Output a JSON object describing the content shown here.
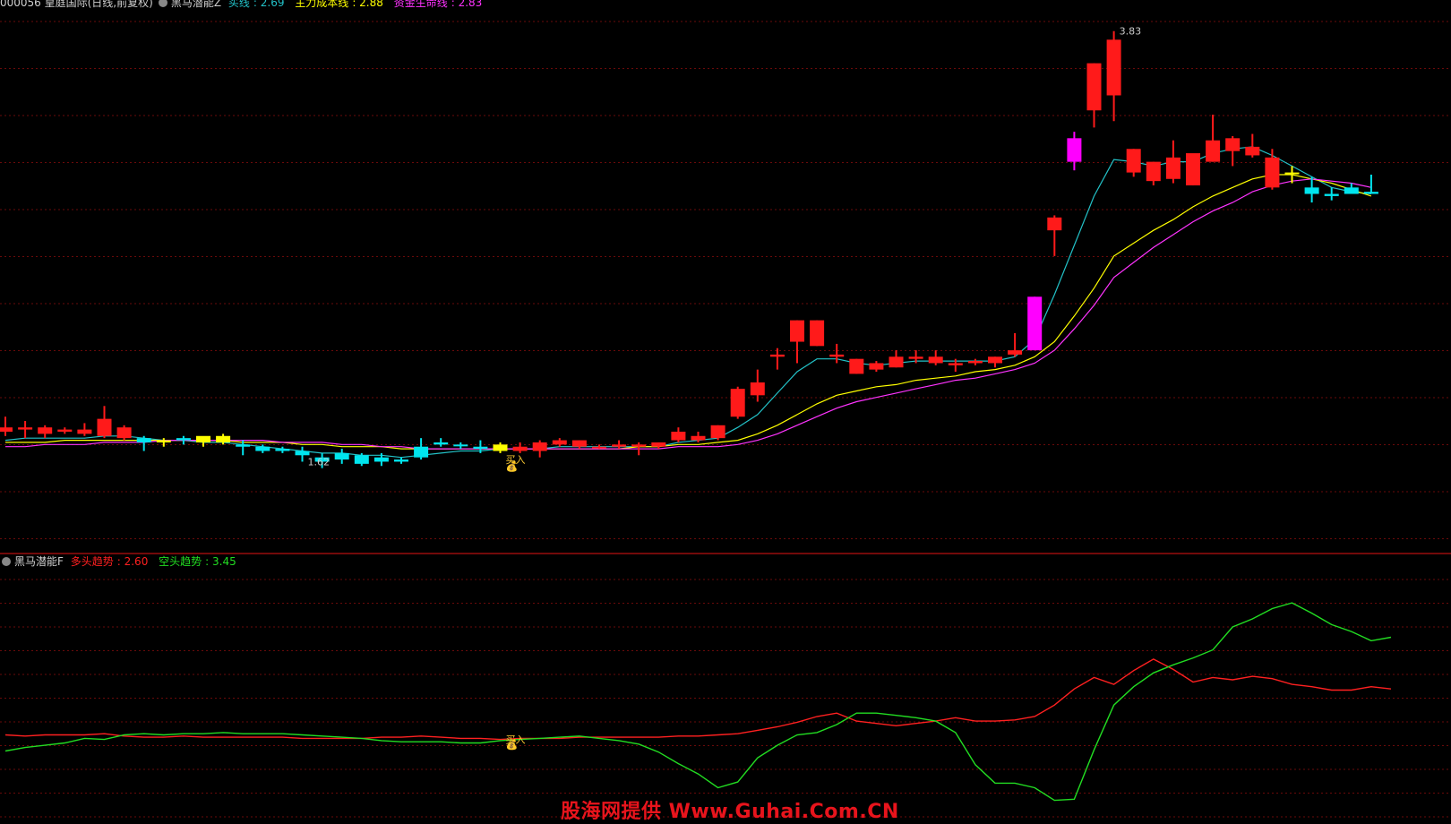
{
  "header": {
    "title": "000056 皇庭国际(日线,前复权)",
    "indicator": "黑马潜能Z",
    "items": [
      {
        "label": "买线",
        "value": "2.69",
        "color": "#23c2c8"
      },
      {
        "label": "主力成本线",
        "value": "2.88",
        "color": "#ffff00"
      },
      {
        "label": "资金生命线",
        "value": "2.83",
        "color": "#ff33ff"
      }
    ]
  },
  "sub_header": {
    "indicator": "黑马潜能F",
    "items": [
      {
        "label": "多头趋势",
        "value": "2.60",
        "color": "#ff2020"
      },
      {
        "label": "空头趋势",
        "value": "3.45",
        "color": "#22dd22"
      }
    ]
  },
  "watermark": "股海网提供 Www.Guhai.Com.CN",
  "chart_data": [
    {
      "type": "candlestick",
      "name": "main",
      "ylim": [
        1.5,
        3.9
      ],
      "bull_color": "#ff1a1a",
      "bear_color": "#00e5ee",
      "signal_color": "#ff00ff",
      "warning_color": "#ffff00",
      "candles": [
        [
          1.98,
          2.03,
          1.94,
          1.96,
          "bull"
        ],
        [
          1.97,
          2.01,
          1.93,
          1.98,
          "bull"
        ],
        [
          1.95,
          1.99,
          1.93,
          1.98,
          "bull"
        ],
        [
          1.96,
          1.98,
          1.95,
          1.97,
          "bull"
        ],
        [
          1.95,
          2.0,
          1.94,
          1.97,
          "bull"
        ],
        [
          1.94,
          2.08,
          1.93,
          2.02,
          "bull"
        ],
        [
          1.93,
          1.99,
          1.92,
          1.98,
          "bull"
        ],
        [
          1.93,
          1.94,
          1.87,
          1.91,
          "bear"
        ],
        [
          1.91,
          1.93,
          1.89,
          1.92,
          "warn"
        ],
        [
          1.92,
          1.94,
          1.9,
          1.93,
          "bear"
        ],
        [
          1.91,
          1.93,
          1.89,
          1.94,
          "warn"
        ],
        [
          1.91,
          1.95,
          1.9,
          1.94,
          "warn"
        ],
        [
          1.9,
          1.92,
          1.85,
          1.89,
          "bear"
        ],
        [
          1.89,
          1.9,
          1.86,
          1.87,
          "bear"
        ],
        [
          1.88,
          1.89,
          1.86,
          1.87,
          "bear"
        ],
        [
          1.87,
          1.89,
          1.82,
          1.85,
          "bear"
        ],
        [
          1.84,
          1.86,
          1.79,
          1.82,
          "bear"
        ],
        [
          1.86,
          1.88,
          1.81,
          1.83,
          "bear"
        ],
        [
          1.85,
          1.86,
          1.8,
          1.81,
          "bear"
        ],
        [
          1.84,
          1.86,
          1.8,
          1.82,
          "bear"
        ],
        [
          1.83,
          1.84,
          1.81,
          1.82,
          "bear"
        ],
        [
          1.89,
          1.93,
          1.83,
          1.84,
          "bear"
        ],
        [
          1.91,
          1.93,
          1.89,
          1.9,
          "bear"
        ],
        [
          1.9,
          1.91,
          1.88,
          1.9,
          "bear"
        ],
        [
          1.89,
          1.92,
          1.86,
          1.88,
          "bear"
        ],
        [
          1.87,
          1.91,
          1.86,
          1.9,
          "warn"
        ],
        [
          1.87,
          1.91,
          1.86,
          1.89,
          "bull"
        ],
        [
          1.87,
          1.92,
          1.84,
          1.91,
          "bull"
        ],
        [
          1.9,
          1.93,
          1.89,
          1.92,
          "bull"
        ],
        [
          1.89,
          1.92,
          1.88,
          1.92,
          "bull"
        ],
        [
          1.89,
          1.9,
          1.88,
          1.89,
          "bull"
        ],
        [
          1.89,
          1.92,
          1.88,
          1.9,
          "bull"
        ],
        [
          1.89,
          1.91,
          1.85,
          1.9,
          "bull"
        ],
        [
          1.89,
          1.91,
          1.88,
          1.91,
          "bull"
        ],
        [
          1.92,
          1.98,
          1.91,
          1.96,
          "bull"
        ],
        [
          1.92,
          1.96,
          1.91,
          1.94,
          "bull"
        ],
        [
          1.93,
          1.99,
          1.92,
          1.99,
          "bull"
        ],
        [
          2.03,
          2.17,
          2.02,
          2.16,
          "bull"
        ],
        [
          2.13,
          2.25,
          2.1,
          2.19,
          "bull"
        ],
        [
          2.32,
          2.35,
          2.25,
          2.31,
          "bull"
        ],
        [
          2.38,
          2.48,
          2.28,
          2.48,
          "bull"
        ],
        [
          2.36,
          2.48,
          2.36,
          2.48,
          "bull"
        ],
        [
          2.32,
          2.37,
          2.28,
          2.31,
          "bull"
        ],
        [
          2.23,
          2.3,
          2.23,
          2.3,
          "bull"
        ],
        [
          2.25,
          2.29,
          2.24,
          2.28,
          "bull"
        ],
        [
          2.26,
          2.34,
          2.26,
          2.31,
          "bull"
        ],
        [
          2.3,
          2.34,
          2.28,
          2.31,
          "bull"
        ],
        [
          2.28,
          2.34,
          2.27,
          2.31,
          "bull"
        ],
        [
          2.27,
          2.3,
          2.24,
          2.28,
          "bull"
        ],
        [
          2.28,
          2.3,
          2.27,
          2.29,
          "bull"
        ],
        [
          2.28,
          2.31,
          2.26,
          2.31,
          "bull"
        ],
        [
          2.32,
          2.42,
          2.31,
          2.34,
          "bull"
        ],
        [
          2.34,
          2.59,
          2.34,
          2.59,
          "signal"
        ],
        [
          2.9,
          2.97,
          2.78,
          2.96,
          "bull"
        ],
        [
          3.22,
          3.36,
          3.18,
          3.33,
          "signal"
        ],
        [
          3.46,
          3.68,
          3.38,
          3.68,
          "bull"
        ],
        [
          3.53,
          3.83,
          3.41,
          3.79,
          "bull"
        ],
        [
          3.17,
          3.28,
          3.15,
          3.28,
          "bull"
        ],
        [
          3.13,
          3.22,
          3.11,
          3.22,
          "bull"
        ],
        [
          3.14,
          3.32,
          3.12,
          3.24,
          "bull"
        ],
        [
          3.11,
          3.23,
          3.11,
          3.26,
          "bull"
        ],
        [
          3.22,
          3.44,
          3.22,
          3.32,
          "bull"
        ],
        [
          3.27,
          3.34,
          3.2,
          3.33,
          "bull"
        ],
        [
          3.25,
          3.35,
          3.24,
          3.29,
          "bull"
        ],
        [
          3.1,
          3.28,
          3.09,
          3.24,
          "bull"
        ],
        [
          3.17,
          3.2,
          3.12,
          3.17,
          "warn"
        ],
        [
          3.07,
          3.15,
          3.03,
          3.1,
          "bear"
        ],
        [
          3.07,
          3.1,
          3.04,
          3.06,
          "bear"
        ],
        [
          3.07,
          3.12,
          3.07,
          3.1,
          "bear"
        ],
        [
          3.07,
          3.16,
          3.07,
          3.08,
          "bear"
        ]
      ],
      "lines": [
        {
          "name": "买线",
          "color": "#23c2c8",
          "values": [
            1.92,
            1.93,
            1.93,
            1.93,
            1.93,
            1.94,
            1.94,
            1.93,
            1.92,
            1.92,
            1.91,
            1.91,
            1.9,
            1.89,
            1.88,
            1.87,
            1.86,
            1.86,
            1.85,
            1.85,
            1.84,
            1.85,
            1.86,
            1.87,
            1.87,
            1.88,
            1.88,
            1.88,
            1.89,
            1.89,
            1.89,
            1.89,
            1.89,
            1.89,
            1.91,
            1.92,
            1.93,
            1.98,
            2.04,
            2.14,
            2.24,
            2.3,
            2.3,
            2.28,
            2.27,
            2.28,
            2.29,
            2.29,
            2.29,
            2.29,
            2.29,
            2.31,
            2.39,
            2.6,
            2.83,
            3.06,
            3.23,
            3.22,
            3.2,
            3.22,
            3.22,
            3.26,
            3.28,
            3.29,
            3.25,
            3.2,
            3.15,
            3.1,
            3.08,
            3.07
          ]
        },
        {
          "name": "主力成本线",
          "color": "#ffff00",
          "values": [
            1.91,
            1.91,
            1.91,
            1.92,
            1.92,
            1.92,
            1.92,
            1.92,
            1.92,
            1.92,
            1.92,
            1.92,
            1.91,
            1.91,
            1.91,
            1.9,
            1.9,
            1.89,
            1.89,
            1.89,
            1.88,
            1.88,
            1.88,
            1.88,
            1.88,
            1.88,
            1.88,
            1.88,
            1.88,
            1.88,
            1.88,
            1.88,
            1.89,
            1.89,
            1.9,
            1.9,
            1.91,
            1.92,
            1.95,
            1.99,
            2.04,
            2.09,
            2.13,
            2.15,
            2.17,
            2.18,
            2.2,
            2.21,
            2.22,
            2.24,
            2.25,
            2.27,
            2.31,
            2.38,
            2.5,
            2.63,
            2.78,
            2.84,
            2.9,
            2.95,
            3.01,
            3.06,
            3.1,
            3.14,
            3.16,
            3.16,
            3.14,
            3.12,
            3.09,
            3.06
          ]
        },
        {
          "name": "资金生命线",
          "color": "#ff33ff",
          "values": [
            1.89,
            1.89,
            1.9,
            1.9,
            1.9,
            1.91,
            1.91,
            1.91,
            1.92,
            1.92,
            1.92,
            1.92,
            1.92,
            1.92,
            1.91,
            1.91,
            1.91,
            1.9,
            1.9,
            1.89,
            1.89,
            1.88,
            1.88,
            1.88,
            1.88,
            1.88,
            1.88,
            1.88,
            1.88,
            1.88,
            1.88,
            1.88,
            1.88,
            1.88,
            1.89,
            1.89,
            1.89,
            1.9,
            1.92,
            1.95,
            1.99,
            2.03,
            2.07,
            2.1,
            2.12,
            2.14,
            2.16,
            2.18,
            2.2,
            2.21,
            2.23,
            2.25,
            2.28,
            2.34,
            2.44,
            2.55,
            2.68,
            2.75,
            2.82,
            2.88,
            2.94,
            2.99,
            3.03,
            3.08,
            3.11,
            3.13,
            3.14,
            3.13,
            3.12,
            3.1
          ]
        }
      ],
      "annotations": [
        {
          "text": "3.83",
          "index": 56,
          "y": 3.83
        },
        {
          "text": "1.62",
          "index": 15,
          "y": 1.82
        },
        {
          "text": "买入",
          "index": 25,
          "y": 1.83
        },
        {
          "text": "💰",
          "index": 25,
          "y": 1.8
        }
      ]
    },
    {
      "type": "line",
      "name": "sub",
      "series": [
        {
          "name": "多头趋势",
          "color": "#ff2020",
          "values": [
            2.12,
            2.11,
            2.12,
            2.12,
            2.12,
            2.13,
            2.11,
            2.1,
            2.1,
            2.11,
            2.1,
            2.1,
            2.1,
            2.1,
            2.1,
            2.09,
            2.09,
            2.09,
            2.09,
            2.1,
            2.1,
            2.11,
            2.1,
            2.09,
            2.09,
            2.08,
            2.09,
            2.09,
            2.09,
            2.1,
            2.1,
            2.1,
            2.1,
            2.1,
            2.11,
            2.11,
            2.12,
            2.13,
            2.16,
            2.19,
            2.23,
            2.28,
            2.31,
            2.24,
            2.22,
            2.2,
            2.22,
            2.24,
            2.27,
            2.24,
            2.24,
            2.25,
            2.28,
            2.38,
            2.52,
            2.62,
            2.56,
            2.68,
            2.78,
            2.69,
            2.58,
            2.62,
            2.6,
            2.63,
            2.61,
            2.56,
            2.54,
            2.51,
            2.51,
            2.54,
            2.52
          ]
        },
        {
          "name": "空头趋势",
          "color": "#22dd22",
          "values": [
            1.98,
            2.01,
            2.03,
            2.05,
            2.09,
            2.08,
            2.12,
            2.13,
            2.12,
            2.13,
            2.13,
            2.14,
            2.13,
            2.13,
            2.13,
            2.12,
            2.11,
            2.1,
            2.09,
            2.07,
            2.06,
            2.06,
            2.06,
            2.05,
            2.05,
            2.07,
            2.08,
            2.09,
            2.1,
            2.11,
            2.09,
            2.07,
            2.04,
            1.97,
            1.87,
            1.78,
            1.66,
            1.71,
            1.92,
            2.03,
            2.12,
            2.14,
            2.21,
            2.31,
            2.31,
            2.29,
            2.27,
            2.24,
            2.14,
            1.86,
            1.7,
            1.7,
            1.66,
            1.55,
            1.56,
            1.99,
            2.38,
            2.54,
            2.66,
            2.73,
            2.79,
            2.86,
            3.06,
            3.13,
            3.22,
            3.27,
            3.18,
            3.08,
            3.02,
            2.94,
            2.97
          ]
        }
      ],
      "ylim": [
        1.5,
        3.45
      ],
      "annotations": [
        {
          "text": "买入",
          "index": 25,
          "y": 2.08
        },
        {
          "text": "💰",
          "index": 25,
          "y": 2.04
        }
      ]
    }
  ]
}
